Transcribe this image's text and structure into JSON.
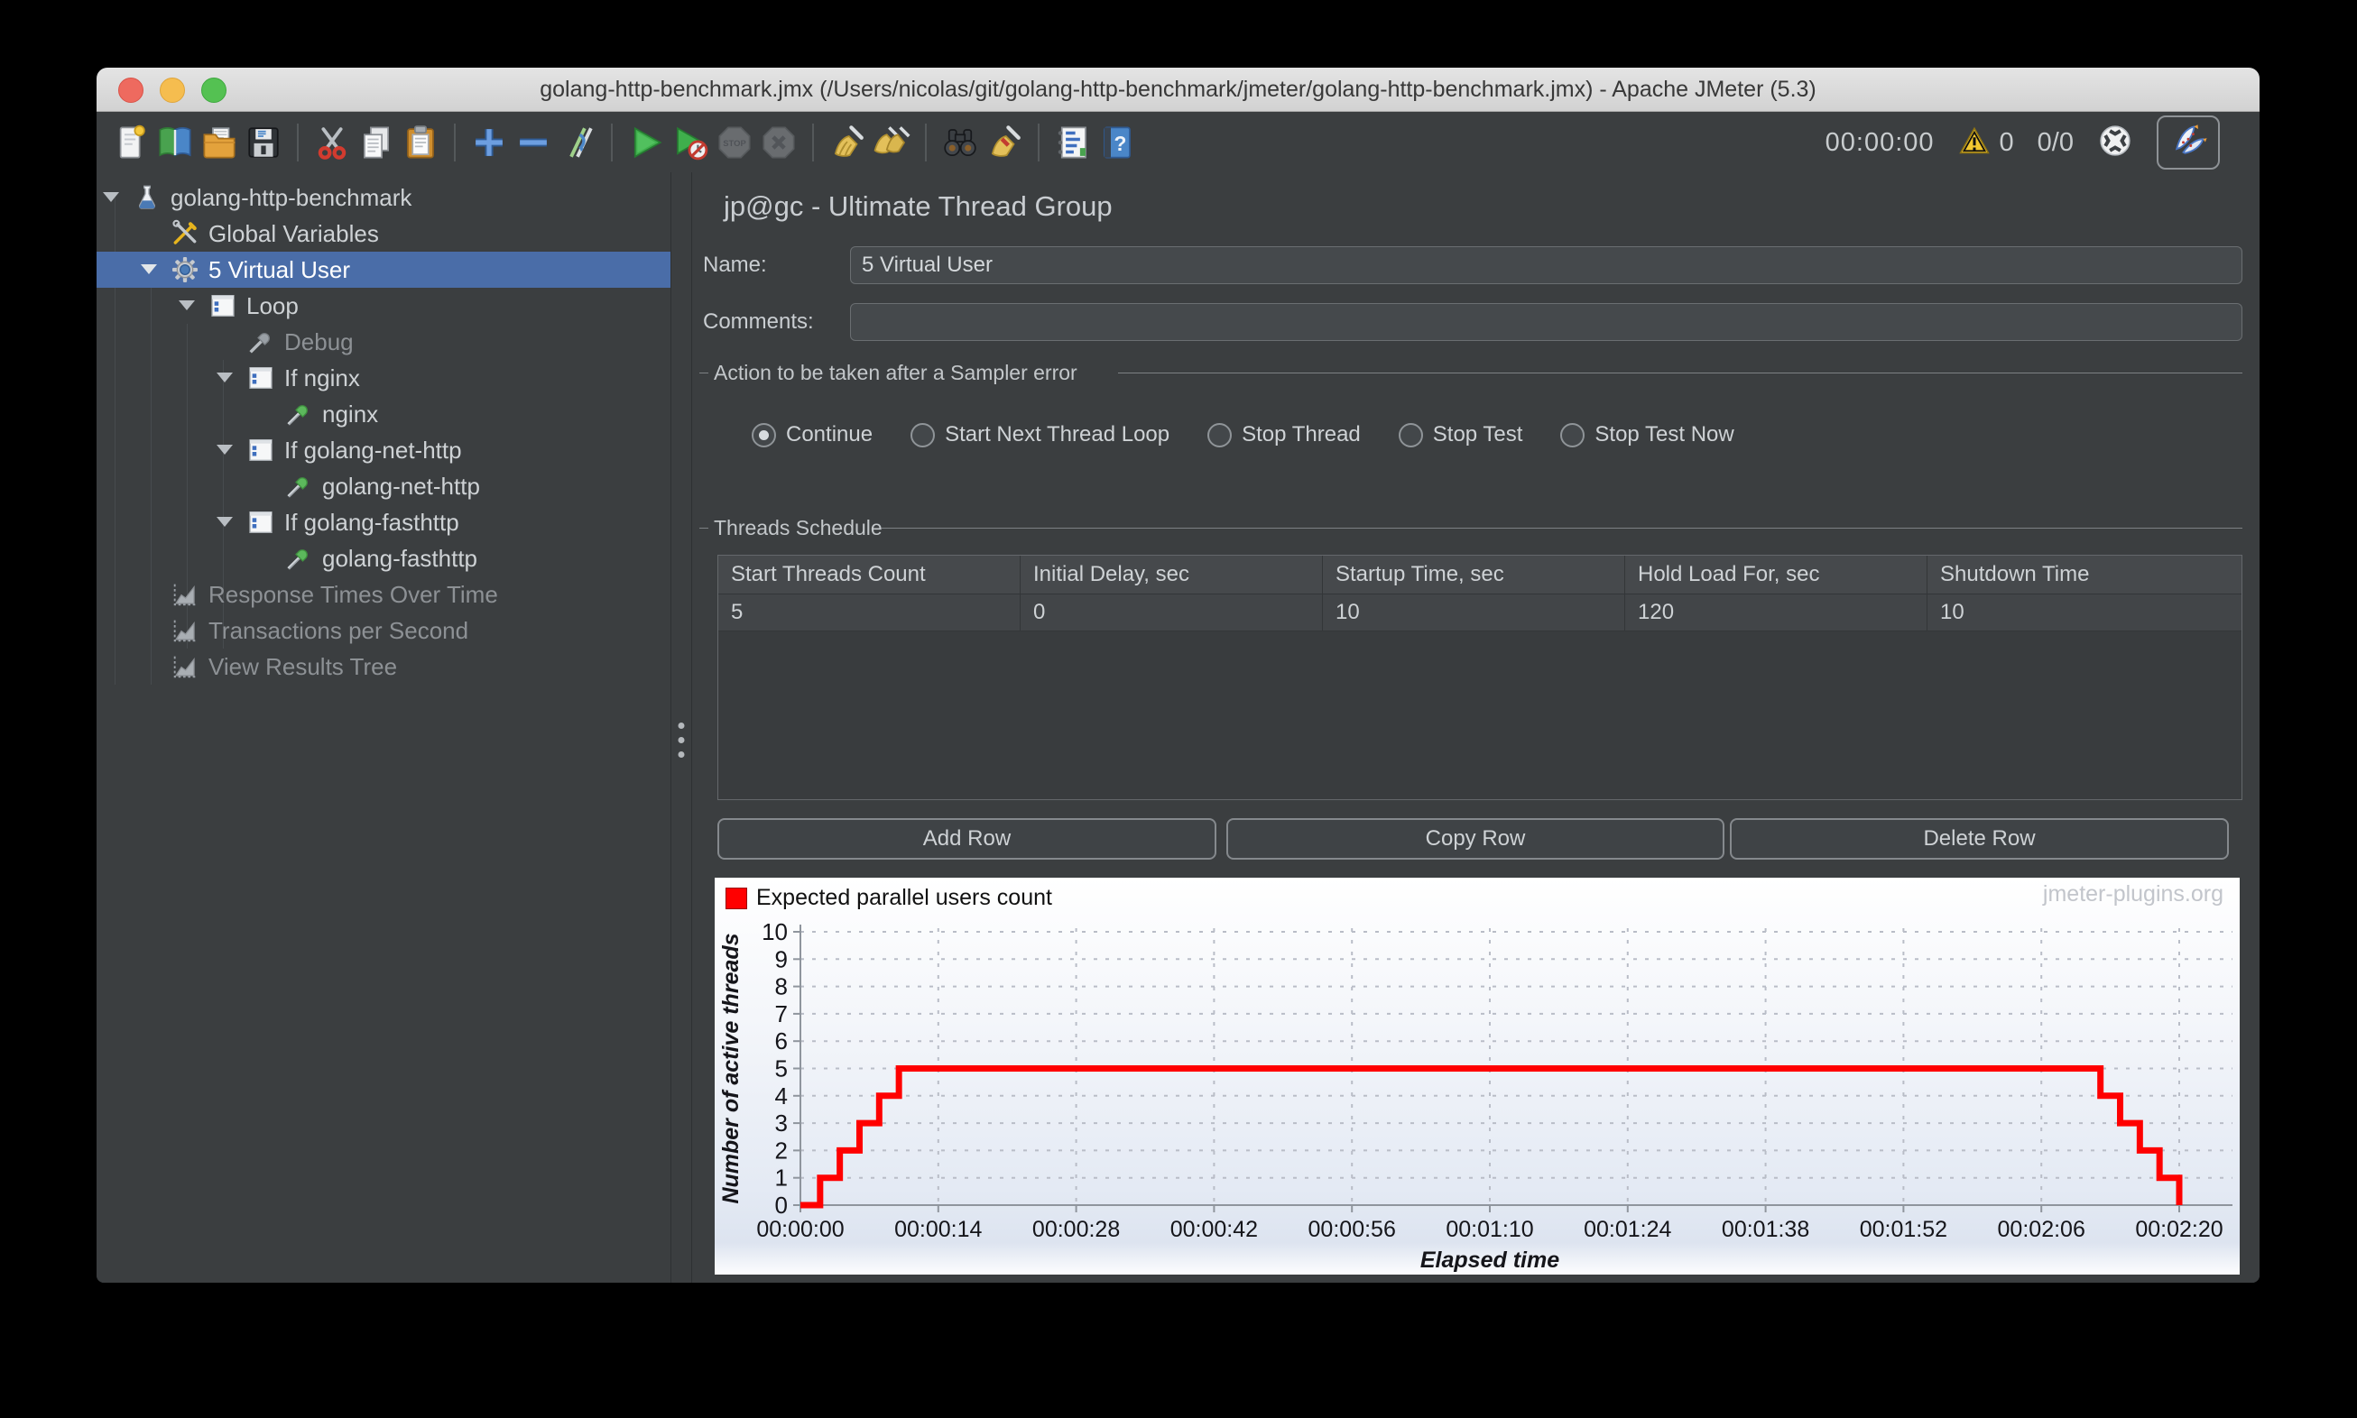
{
  "window": {
    "title": "golang-http-benchmark.jmx (/Users/nicolas/git/golang-http-benchmark/jmeter/golang-http-benchmark.jmx) - Apache JMeter (5.3)"
  },
  "toolbar": {
    "left_icons": [
      "new-file",
      "templates",
      "open-file",
      "save",
      "sep",
      "cut",
      "copy",
      "paste",
      "sep",
      "add",
      "remove",
      "toggle",
      "sep",
      "start",
      "start-no-pauses",
      "stop",
      "shutdown",
      "sep",
      "clear",
      "clear-all",
      "sep",
      "search",
      "search-reset",
      "sep",
      "function-helper",
      "help"
    ],
    "timer": "00:00:00",
    "warning_count": "0",
    "thread_count": "0/0",
    "right_icons": [
      "remote-sphere",
      "rabbit"
    ]
  },
  "sidebar": {
    "items": [
      {
        "label": "golang-http-benchmark",
        "icon": "test-plan",
        "level": 0,
        "expanded": true,
        "enabled": true,
        "selected": false
      },
      {
        "label": "Global Variables",
        "icon": "toolkit",
        "level": 1,
        "expanded": false,
        "enabled": true,
        "selected": false
      },
      {
        "label": "5 Virtual User",
        "icon": "gear",
        "level": 1,
        "expanded": true,
        "enabled": true,
        "selected": true
      },
      {
        "label": "Loop",
        "icon": "controller",
        "level": 2,
        "expanded": true,
        "enabled": true,
        "selected": false
      },
      {
        "label": "Debug",
        "icon": "sampler-gray",
        "level": 3,
        "expanded": false,
        "enabled": false,
        "selected": false
      },
      {
        "label": "If nginx",
        "icon": "controller",
        "level": 3,
        "expanded": true,
        "enabled": true,
        "selected": false
      },
      {
        "label": "nginx",
        "icon": "sampler-green",
        "level": 4,
        "expanded": false,
        "enabled": true,
        "selected": false
      },
      {
        "label": "If golang-net-http",
        "icon": "controller",
        "level": 3,
        "expanded": true,
        "enabled": true,
        "selected": false
      },
      {
        "label": "golang-net-http",
        "icon": "sampler-green",
        "level": 4,
        "expanded": false,
        "enabled": true,
        "selected": false
      },
      {
        "label": "If golang-fasthttp",
        "icon": "controller",
        "level": 3,
        "expanded": true,
        "enabled": true,
        "selected": false
      },
      {
        "label": "golang-fasthttp",
        "icon": "sampler-green",
        "level": 4,
        "expanded": false,
        "enabled": true,
        "selected": false
      },
      {
        "label": "Response Times Over Time",
        "icon": "chart",
        "level": 1,
        "expanded": false,
        "enabled": false,
        "selected": false
      },
      {
        "label": "Transactions per Second",
        "icon": "chart",
        "level": 1,
        "expanded": false,
        "enabled": false,
        "selected": false
      },
      {
        "label": "View Results Tree",
        "icon": "chart",
        "level": 1,
        "expanded": false,
        "enabled": false,
        "selected": false
      }
    ]
  },
  "main": {
    "panel_title": "jp@gc - Ultimate Thread Group",
    "name_label": "Name:",
    "name_value": "5 Virtual User",
    "comments_label": "Comments:",
    "comments_value": "",
    "sampler_error": {
      "title": "Action to be taken after a Sampler error",
      "options": [
        {
          "label": "Continue",
          "selected": true
        },
        {
          "label": "Start Next Thread Loop",
          "selected": false
        },
        {
          "label": "Stop Thread",
          "selected": false
        },
        {
          "label": "Stop Test",
          "selected": false
        },
        {
          "label": "Stop Test Now",
          "selected": false
        }
      ]
    },
    "schedule": {
      "title": "Threads Schedule",
      "columns": [
        "Start Threads Count",
        "Initial Delay, sec",
        "Startup Time, sec",
        "Hold Load For, sec",
        "Shutdown Time"
      ],
      "rows": [
        [
          "5",
          "0",
          "10",
          "120",
          "10"
        ]
      ],
      "buttons": [
        "Add Row",
        "Copy Row",
        "Delete Row"
      ]
    }
  },
  "chart_data": {
    "type": "line",
    "step": true,
    "legend": "Expected parallel users count",
    "series": [
      {
        "name": "Expected parallel users count",
        "color": "#ff0000",
        "x_sec": [
          0,
          2,
          4,
          6,
          8,
          10,
          130,
          132,
          134,
          136,
          138,
          140
        ],
        "y": [
          0,
          1,
          2,
          3,
          4,
          5,
          5,
          4,
          3,
          2,
          1,
          0
        ]
      }
    ],
    "xlabel": "Elapsed time",
    "ylabel": "Number of active threads",
    "x_ticks": [
      {
        "sec": 0,
        "label": "00:00:00"
      },
      {
        "sec": 14,
        "label": "00:00:14"
      },
      {
        "sec": 28,
        "label": "00:00:28"
      },
      {
        "sec": 42,
        "label": "00:00:42"
      },
      {
        "sec": 56,
        "label": "00:00:56"
      },
      {
        "sec": 70,
        "label": "00:01:10"
      },
      {
        "sec": 84,
        "label": "00:01:24"
      },
      {
        "sec": 98,
        "label": "00:01:38"
      },
      {
        "sec": 112,
        "label": "00:01:52"
      },
      {
        "sec": 126,
        "label": "00:02:06"
      },
      {
        "sec": 140,
        "label": "00:02:20"
      }
    ],
    "y_ticks": [
      0,
      1,
      2,
      3,
      4,
      5,
      6,
      7,
      8,
      9,
      10
    ],
    "xlim_sec": [
      0,
      140
    ],
    "ylim": [
      0,
      10
    ],
    "grid": "dashed",
    "watermark": "jmeter-plugins.org"
  }
}
